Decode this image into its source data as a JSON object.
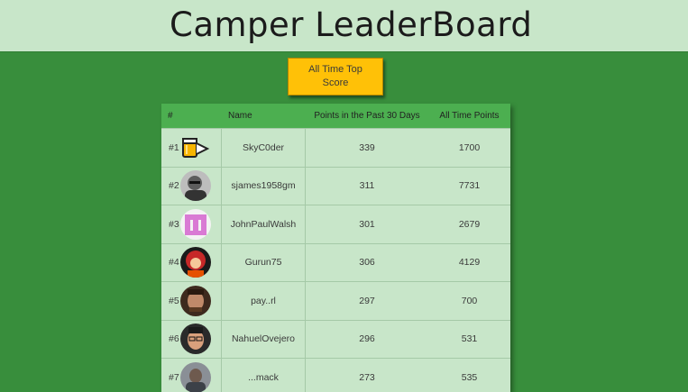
{
  "header": {
    "title": "Camper LeaderBoard"
  },
  "sort_button": {
    "label": "All Time Top Score"
  },
  "table": {
    "columns": {
      "rank": "#",
      "name": "Name",
      "recent": "Points in the Past 30 Days",
      "alltime": "All Time Points"
    },
    "rows": [
      {
        "rank": "#1",
        "name": "SkyC0der",
        "recent": "339",
        "alltime": "1700",
        "avatar": "beer-mug-icon"
      },
      {
        "rank": "#2",
        "name": "sjames1958gm",
        "recent": "311",
        "alltime": "7731",
        "avatar": "user-avatar"
      },
      {
        "rank": "#3",
        "name": "JohnPaulWalsh",
        "recent": "301",
        "alltime": "2679",
        "avatar": "identicon-avatar"
      },
      {
        "rank": "#4",
        "name": "Gurun75",
        "recent": "306",
        "alltime": "4129",
        "avatar": "user-avatar"
      },
      {
        "rank": "#5",
        "name": "pay..rl",
        "recent": "297",
        "alltime": "700",
        "avatar": "user-avatar"
      },
      {
        "rank": "#6",
        "name": "NahuelOvejero",
        "recent": "296",
        "alltime": "531",
        "avatar": "user-avatar"
      },
      {
        "rank": "#7",
        "name": "...mack",
        "recent": "273",
        "alltime": "535",
        "avatar": "user-avatar"
      }
    ]
  },
  "colors": {
    "page_background": "#388e3c",
    "header_background": "#c8e6c9",
    "table_header": "#4caf50",
    "button": "#ffc107"
  }
}
